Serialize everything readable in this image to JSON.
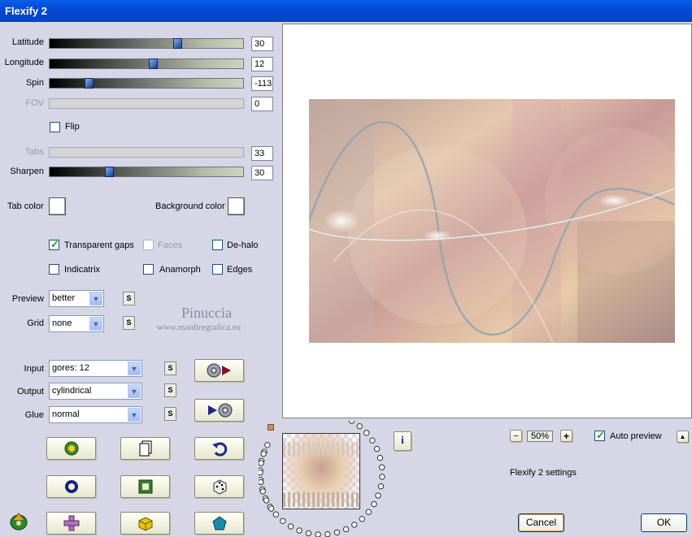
{
  "window": {
    "title": "Flexify 2"
  },
  "sliders": [
    {
      "label": "Latitude",
      "value": "30",
      "pos": 0.66,
      "enabled": true
    },
    {
      "label": "Longitude",
      "value": "12",
      "pos": 0.53,
      "enabled": true
    },
    {
      "label": "Spin",
      "value": "-113",
      "pos": 0.19,
      "enabled": true
    },
    {
      "label": "FOV",
      "value": "0",
      "pos": 0,
      "enabled": false
    },
    {
      "label": "Tabs",
      "value": "33",
      "pos": 0,
      "enabled": false
    },
    {
      "label": "Sharpen",
      "value": "30",
      "pos": 0.3,
      "enabled": true
    }
  ],
  "flip": {
    "label": "Flip",
    "checked": false
  },
  "colors": {
    "tab_label": "Tab color",
    "background_label": "Background color",
    "tab_value": "#ffffff",
    "background_value": "#ffffff"
  },
  "checkboxes": {
    "transparent_gaps": {
      "label": "Transparent gaps",
      "checked": true
    },
    "faces": {
      "label": "Faces",
      "checked": false,
      "enabled": false
    },
    "de_halo": {
      "label": "De-halo",
      "checked": false
    },
    "indicatrix": {
      "label": "Indicatrix",
      "checked": false
    },
    "anamorph": {
      "label": "Anamorph",
      "checked": false
    },
    "edges": {
      "label": "Edges",
      "checked": false
    }
  },
  "dropdowns": {
    "preview": {
      "label": "Preview",
      "value": "better"
    },
    "grid": {
      "label": "Grid",
      "value": "none"
    },
    "input": {
      "label": "Input",
      "value": "gores: 12"
    },
    "output": {
      "label": "Output",
      "value": "cylindrical"
    },
    "glue": {
      "label": "Glue",
      "value": "normal"
    }
  },
  "small_button_label": "S",
  "watermark": {
    "name": "Pinuccia",
    "url": "www.maidiregrafica.eu"
  },
  "zoom": {
    "minus": "−",
    "value": "50%",
    "plus": "+"
  },
  "auto_preview": {
    "label": "Auto preview",
    "checked": true
  },
  "scroll_up": "▲",
  "info_icon": "i",
  "settings_text": "Flexify 2 settings",
  "buttons": {
    "cancel": "Cancel",
    "ok": "OK"
  },
  "icons": [
    "globe-play-icon",
    "play-disc-icon",
    "filter-icon",
    "new-page-icon",
    "undo-icon",
    "torus-icon",
    "square-icon",
    "dice-icon",
    "plugin-icon",
    "plus-cross-icon",
    "cube-icon",
    "pentagon-icon"
  ],
  "accent_colors": {
    "titlebar": "#0348d6",
    "check": "#21a121",
    "slider_thumb": "#1a3f90"
  }
}
